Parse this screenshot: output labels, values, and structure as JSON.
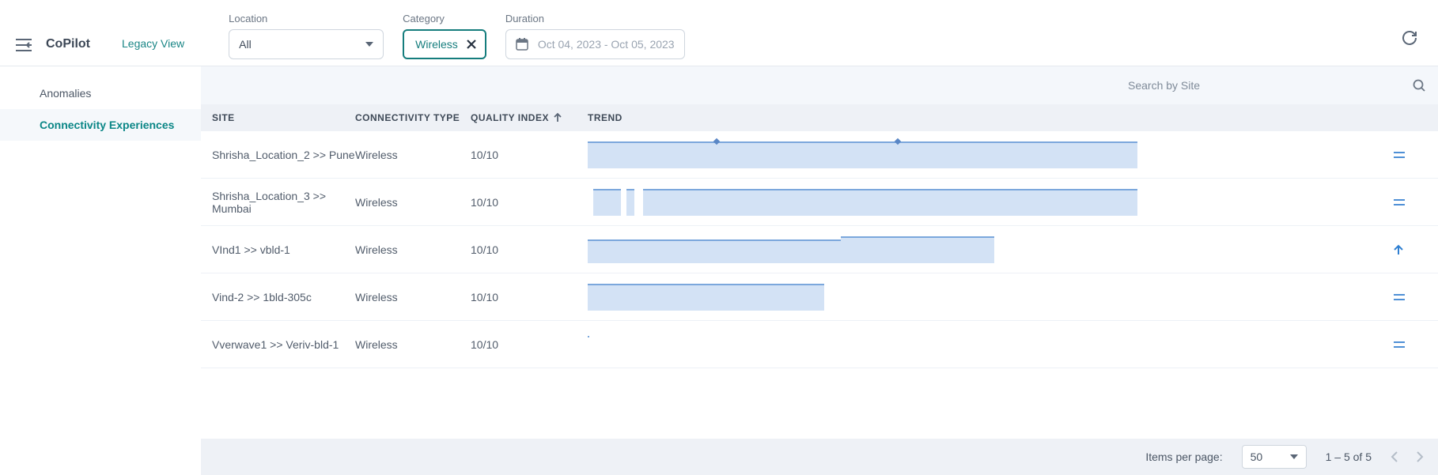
{
  "header": {
    "brand": "CoPilot",
    "legacy_view": "Legacy View"
  },
  "filters": {
    "location_label": "Location",
    "location_value": "All",
    "category_label": "Category",
    "category_value": "Wireless",
    "duration_label": "Duration",
    "duration_value": "Oct 04, 2023 - Oct 05, 2023"
  },
  "sidebar": {
    "items": [
      {
        "label": "Anomalies",
        "active": false
      },
      {
        "label": "Connectivity Experiences",
        "active": true
      }
    ]
  },
  "search": {
    "placeholder": "Search by Site"
  },
  "table": {
    "headers": {
      "site": "Site",
      "conn": "Connectivity Type",
      "quality": "Quality Index",
      "trend": "Trend"
    },
    "rows": [
      {
        "site": "Shrisha_Location_2 >> Pune",
        "conn": "Wireless",
        "quality": "10/10",
        "trend_type": "full_dots",
        "action": "equals"
      },
      {
        "site": "Shrisha_Location_3 >> Mumbai",
        "conn": "Wireless",
        "quality": "10/10",
        "trend_type": "gapped",
        "action": "equals"
      },
      {
        "site": "VInd1 >> vbld-1",
        "conn": "Wireless",
        "quality": "10/10",
        "trend_type": "step",
        "action": "up"
      },
      {
        "site": "Vind-2 >> 1bld-305c",
        "conn": "Wireless",
        "quality": "10/10",
        "trend_type": "short",
        "action": "equals"
      },
      {
        "site": "Vverwave1 >> Veriv-bld-1",
        "conn": "Wireless",
        "quality": "10/10",
        "trend_type": "tiny",
        "action": "equals"
      }
    ]
  },
  "pagination": {
    "items_per_page_label": "Items per page:",
    "items_per_page_value": "50",
    "range_text": "1 – 5 of 5"
  }
}
